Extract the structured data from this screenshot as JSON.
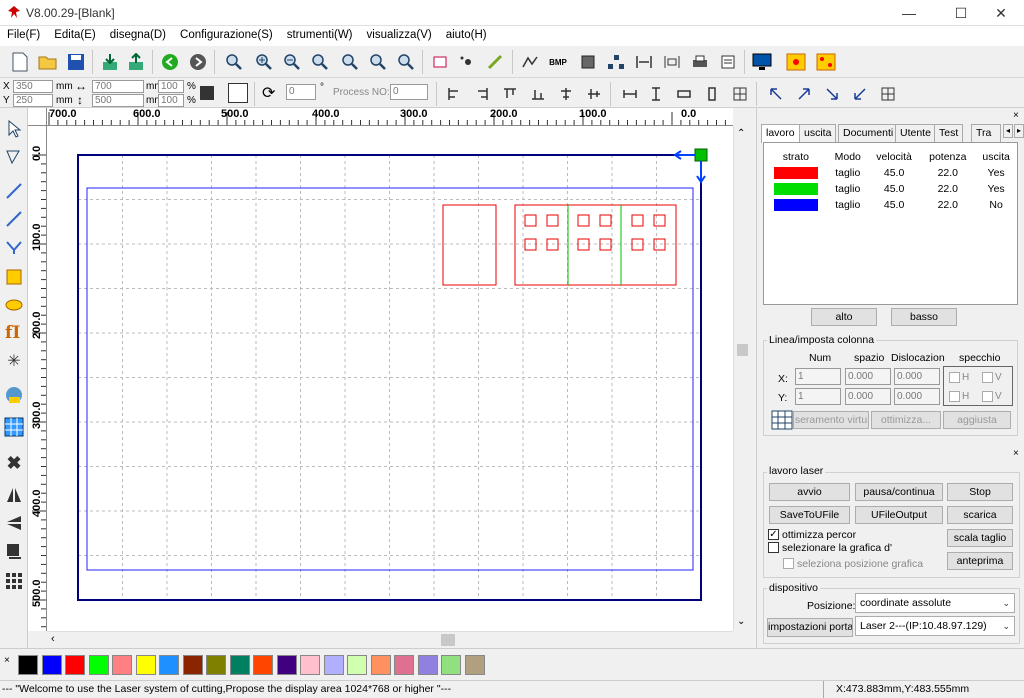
{
  "window": {
    "title": "V8.00.29-[Blank]",
    "minimize": "—",
    "maximize": "☐",
    "close": "✕"
  },
  "menu": [
    "File(F)",
    "Edita(E)",
    "disegna(D)",
    "Configurazione(S)",
    "strumenti(W)",
    "visualizza(V)",
    "aiuto(H)"
  ],
  "toolbar2": {
    "x_label": "X",
    "y_label": "Y",
    "x_value": "350",
    "y_value": "250",
    "unit": "mm",
    "width_value": "700",
    "height_value": "500",
    "scale_x": "100",
    "scale_y": "100",
    "percent": "%",
    "rotation_value": "0",
    "degree": "°",
    "process_label": "Process NO:",
    "process_value": "0"
  },
  "ruler": {
    "h_labels": [
      "700.0",
      "600.0",
      "500.0",
      "400.0",
      "300.0",
      "200.0",
      "100.0",
      "0.0"
    ],
    "v_labels": [
      "0.0",
      "100.0",
      "200.0",
      "300.0",
      "400.0",
      "500.0"
    ]
  },
  "panel": {
    "tabs": [
      "lavoro",
      "uscita",
      "Documenti",
      "Utente",
      "Test",
      "Tra"
    ],
    "layer_headers": [
      "strato",
      "Modo",
      "velocità",
      "potenza",
      "uscita"
    ],
    "layers": [
      {
        "color": "#ff0000",
        "mode": "taglio",
        "speed": "45.0",
        "power": "22.0",
        "output": "Yes"
      },
      {
        "color": "#00dd00",
        "mode": "taglio",
        "speed": "45.0",
        "power": "22.0",
        "output": "Yes"
      },
      {
        "color": "#0000ff",
        "mode": "taglio",
        "speed": "45.0",
        "power": "22.0",
        "output": "No"
      }
    ],
    "btn_up": "alto",
    "btn_down": "basso",
    "array_group": "Linea/imposta colonna",
    "array_headers": [
      "Num",
      "spazio",
      "Dislocazione",
      "specchio"
    ],
    "array_x_label": "X:",
    "array_y_label": "Y:",
    "array_x": {
      "num": "1",
      "space": "0.000",
      "offset": "0.000"
    },
    "array_y": {
      "num": "1",
      "space": "0.000",
      "offset": "0.000"
    },
    "mirror_h": "H",
    "mirror_v": "V",
    "btn_virtual": "seramento virtu",
    "btn_optimize": "ottimizza...",
    "btn_adjust": "aggiusta",
    "laser_group": "lavoro laser",
    "btn_start": "avvio",
    "btn_pause": "pausa/continua",
    "btn_stop": "Stop",
    "btn_savetou": "SaveToUFile",
    "btn_ufileout": "UFileOutput",
    "btn_download": "scarica",
    "chk_optimize": "ottimizza percor",
    "chk_select": "selezionare la grafica d'u",
    "chk_position": "seleziona posizione grafica",
    "btn_cut_scale": "scala taglio",
    "btn_preview": "anteprima",
    "device_group": "dispositivo",
    "position_label": "Posizione:",
    "position_value": "coordinate assolute",
    "btn_port": "impostazioni porta",
    "laser_value": "Laser 2---(IP:10.48.97.129)"
  },
  "palette": [
    "#000000",
    "#0000ff",
    "#ff0000",
    "#00ff00",
    "#ff8080",
    "#ffff00",
    "#1e90ff",
    "#8b2500",
    "#808000",
    "#008060",
    "#ff4500",
    "#400080",
    "#ffc0cb",
    "#b0b0ff",
    "#d0ffb0",
    "#ff9060",
    "#e07090",
    "#9080e0",
    "#90e080",
    "#b0a080"
  ],
  "status": {
    "message": "--- \"Welcome to use the Laser system of cutting,Propose the display area 1024*768 or higher \"---",
    "coords": "X:473.883mm,Y:483.555mm"
  }
}
